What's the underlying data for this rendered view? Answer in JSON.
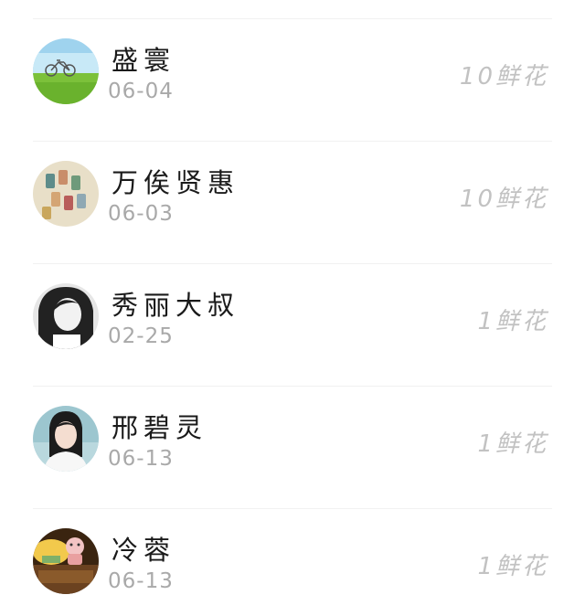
{
  "list": {
    "items": [
      {
        "name": "盛寰",
        "date": "06-04",
        "flowers": "10鲜花",
        "avatar_icon": "bicycle-meadow-avatar"
      },
      {
        "name": "万俟贤惠",
        "date": "06-03",
        "flowers": "10鲜花",
        "avatar_icon": "thread-spools-avatar"
      },
      {
        "name": "秀丽大叔",
        "date": "02-25",
        "flowers": "1鲜花",
        "avatar_icon": "portrait-bw-avatar"
      },
      {
        "name": "邢碧灵",
        "date": "06-13",
        "flowers": "1鲜花",
        "avatar_icon": "portrait-girl-avatar"
      },
      {
        "name": "冷蓉",
        "date": "06-13",
        "flowers": "1鲜花",
        "avatar_icon": "cake-toy-avatar"
      }
    ]
  },
  "colors": {
    "name": "#1a1a1a",
    "date": "#a9a9a9",
    "flowers": "#c2c2c2",
    "divider": "#f1f1f1"
  }
}
